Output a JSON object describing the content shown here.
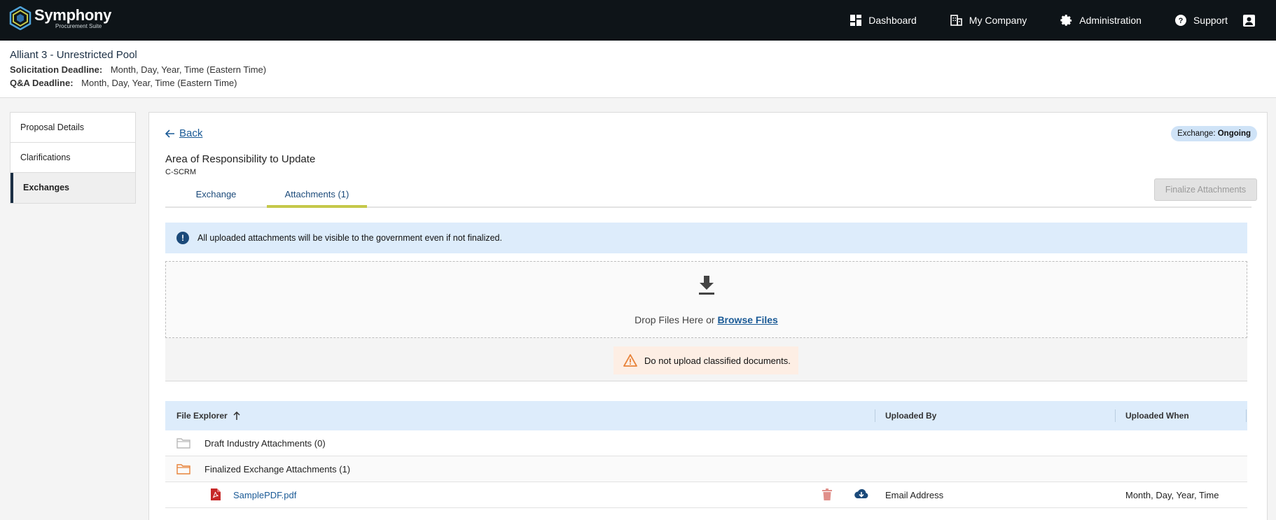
{
  "brand": {
    "name": "Symphony",
    "tagline": "Procurement Suite"
  },
  "nav": {
    "dashboard": "Dashboard",
    "my_company": "My Company",
    "administration": "Administration",
    "support": "Support"
  },
  "header": {
    "title": "Alliant 3 - Unrestricted Pool",
    "solicitation_label": "Solicitation Deadline:",
    "solicitation_value": "Month, Day, Year, Time (Eastern Time)",
    "qa_label": "Q&A Deadline:",
    "qa_value": "Month, Day, Year, Time (Eastern Time)"
  },
  "sidebar": {
    "items": [
      {
        "label": "Proposal Details"
      },
      {
        "label": "Clarifications"
      },
      {
        "label": "Exchanges",
        "active": true
      }
    ]
  },
  "main": {
    "back_label": "Back",
    "status_label": "Exchange:",
    "status_value": "Ongoing",
    "aor_title": "Area of Responsibility to Update",
    "aor_sub": "C-SCRM",
    "finalize_label": "Finalize Attachments",
    "tabs": [
      {
        "label": "Exchange"
      },
      {
        "label": "Attachments (1)",
        "active": true
      }
    ],
    "info_banner": "All uploaded attachments will be visible to the government even if not finalized.",
    "dropzone": {
      "text": "Drop Files Here or",
      "browse": "Browse Files"
    },
    "warning": "Do not upload classified documents.",
    "table": {
      "headers": {
        "file": "File Explorer",
        "by": "Uploaded By",
        "when": "Uploaded When"
      },
      "rows": [
        {
          "type": "folder",
          "name": "Draft Industry Attachments (0)",
          "color": "#b9b9b9"
        },
        {
          "type": "folder",
          "name": "Finalized Exchange Attachments (1)",
          "color": "#e8833a"
        },
        {
          "type": "file",
          "name": "SamplePDF.pdf",
          "by": "Email Address",
          "when": "Month, Day, Year, Time"
        }
      ]
    }
  },
  "colors": {
    "topbar": "#0e1418",
    "accent": "#1b4a7a",
    "tab_underline": "#c5c84a",
    "info_bg": "#ddecfb",
    "warn_bg": "#fdeee4"
  }
}
